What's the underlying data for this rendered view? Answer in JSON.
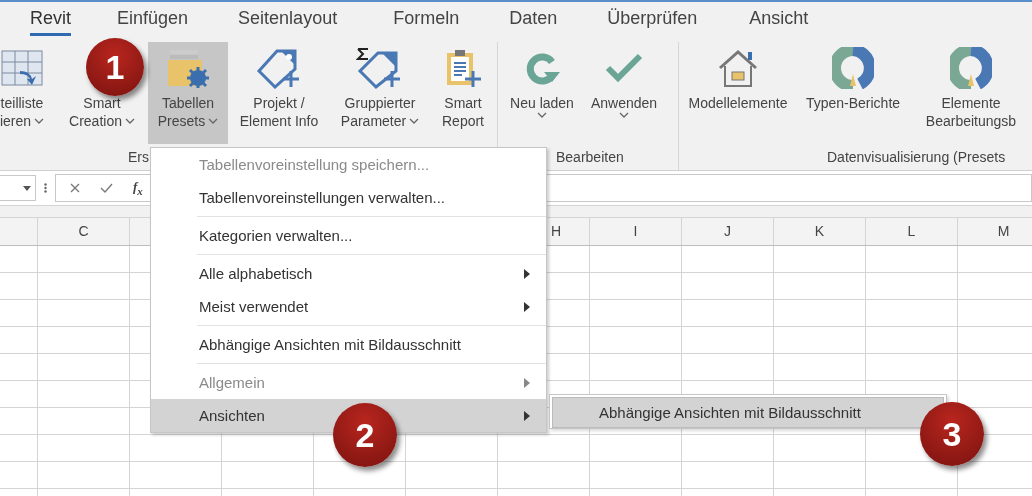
{
  "tabs": [
    {
      "label": "Revit",
      "selected": true
    },
    {
      "label": "Einfügen",
      "selected": false
    },
    {
      "label": "Seitenlayout",
      "selected": false
    },
    {
      "label": "Formeln",
      "selected": false
    },
    {
      "label": "Daten",
      "selected": false
    },
    {
      "label": "Überprüfen",
      "selected": false
    },
    {
      "label": "Ansicht",
      "selected": false
    }
  ],
  "ribbon": {
    "groups": [
      {
        "label": "Ers",
        "buttons": [
          {
            "lines": [
              "teilliste",
              "ieren"
            ],
            "dropdown": true,
            "pressed": false
          },
          {
            "lines": [
              "Smart",
              "Creation"
            ],
            "dropdown": true,
            "pressed": false
          },
          {
            "lines": [
              "Tabellen",
              "Presets"
            ],
            "dropdown": true,
            "pressed": true
          },
          {
            "lines": [
              "Projekt /",
              "Element Info"
            ],
            "dropdown": false,
            "pressed": false
          },
          {
            "lines": [
              "Gruppierter",
              "Parameter"
            ],
            "dropdown": true,
            "pressed": false
          },
          {
            "lines": [
              "Smart",
              "Report"
            ],
            "dropdown": false,
            "pressed": false
          }
        ]
      },
      {
        "label": "Bearbeiten",
        "buttons": [
          {
            "lines": [
              "Neu laden"
            ],
            "dropdown": true,
            "pressed": false
          },
          {
            "lines": [
              "Anwenden"
            ],
            "dropdown": true,
            "pressed": false
          }
        ]
      },
      {
        "label": "Datenvisualisierung (Presets",
        "buttons": [
          {
            "lines": [
              "Modellelemente"
            ],
            "dropdown": false,
            "pressed": false
          },
          {
            "lines": [
              "Typen-Berichte"
            ],
            "dropdown": false,
            "pressed": false
          },
          {
            "lines": [
              "Elemente",
              "Bearbeitungsb"
            ],
            "dropdown": false,
            "pressed": false
          }
        ]
      }
    ]
  },
  "formula_bar": {
    "function_symbol": "f$_{x}$"
  },
  "column_headers": [
    "C",
    "H",
    "I",
    "J",
    "K",
    "L",
    "M"
  ],
  "menu": {
    "items": [
      {
        "label": "Tabellenvoreinstellung speichern...",
        "disabled": true,
        "submenu": false,
        "selected": false,
        "separator_before": false
      },
      {
        "label": "Tabellenvoreinstellungen verwalten...",
        "disabled": false,
        "submenu": false,
        "selected": false,
        "separator_before": false
      },
      {
        "label": "Kategorien verwalten...",
        "disabled": false,
        "submenu": false,
        "selected": false,
        "separator_before": true
      },
      {
        "label": "Alle alphabetisch",
        "disabled": false,
        "submenu": true,
        "selected": false,
        "separator_before": true
      },
      {
        "label": "Meist verwendet",
        "disabled": false,
        "submenu": true,
        "selected": false,
        "separator_before": false
      },
      {
        "label": "Abhängige Ansichten mit Bildausschnitt",
        "disabled": false,
        "submenu": false,
        "selected": false,
        "separator_before": true
      },
      {
        "label": "Allgemein",
        "disabled": true,
        "submenu": true,
        "selected": false,
        "separator_before": true
      },
      {
        "label": "Ansichten",
        "disabled": false,
        "submenu": true,
        "selected": true,
        "separator_before": false
      }
    ]
  },
  "submenu": {
    "items": [
      {
        "label": "Abhängige Ansichten mit Bildausschnitt",
        "selected": true
      }
    ]
  },
  "badges": [
    "1",
    "2",
    "3"
  ]
}
